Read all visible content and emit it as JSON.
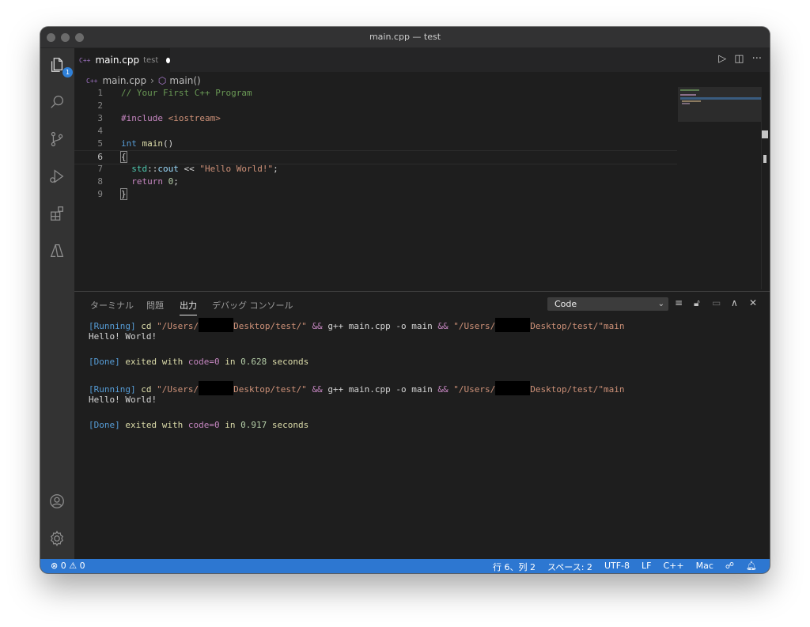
{
  "window": {
    "title": "main.cpp — test"
  },
  "activity": {
    "explorer_badge": "1"
  },
  "tab": {
    "name": "main.cpp",
    "desc": "test",
    "lang_icon": "C++"
  },
  "breadcrumb": {
    "file": "main.cpp",
    "symbol": "main()"
  },
  "editor": {
    "lines": [
      {
        "n": "1"
      },
      {
        "n": "2"
      },
      {
        "n": "3"
      },
      {
        "n": "4"
      },
      {
        "n": "5"
      },
      {
        "n": "6"
      },
      {
        "n": "7"
      },
      {
        "n": "8"
      },
      {
        "n": "9"
      }
    ],
    "code": {
      "comment": "// Your First C++ Program",
      "include": "#include",
      "header": "<iostream>",
      "int": "int",
      "main": "main",
      "parens": "()",
      "open_brace": "{",
      "std": "std",
      "scope": "::",
      "cout": "cout",
      "op": "<<",
      "hello": "\"Hello World!\"",
      "semi": ";",
      "return": "return",
      "zero": "0",
      "close_brace": "}"
    }
  },
  "panel": {
    "tabs": [
      "ターミナル",
      "問題",
      "出力",
      "デバッグ コンソール"
    ],
    "dropdown_value": "Code",
    "output": {
      "running": "[Running]",
      "cd": "cd",
      "path1": "\"/Users/",
      "path1_end": "Desktop/test/\"",
      "amp": "&&",
      "cmd": "g++ main.cpp -o main",
      "path2": "\"/Users/",
      "path2_end": "Desktop/test/\"main",
      "hello": "Hello! World!",
      "done": "[Done]",
      "exited": "exited with",
      "code": "code=0",
      "in": "in",
      "time1": "0.628",
      "time2": "0.917",
      "seconds": "seconds"
    }
  },
  "statusbar": {
    "errors": "0",
    "warnings": "0",
    "position": "行 6、列 2",
    "spaces": "スペース: 2",
    "encoding": "UTF-8",
    "eol": "LF",
    "language": "C++",
    "platform": "Mac"
  }
}
